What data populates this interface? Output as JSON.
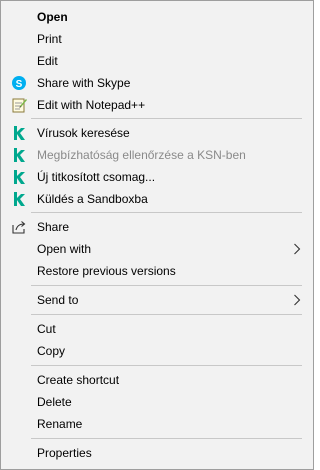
{
  "menu": {
    "open": "Open",
    "print": "Print",
    "edit": "Edit",
    "share_skype": "Share with Skype",
    "edit_notepad": "Edit with Notepad++",
    "kaspersky_scan": "Vírusok keresése",
    "kaspersky_ksn": "Megbízhatóság ellenőrzése a KSN-ben",
    "kaspersky_repack": "Új titkosított csomag...",
    "kaspersky_sandbox": "Küldés a Sandboxba",
    "share": "Share",
    "open_with": "Open with",
    "restore": "Restore previous versions",
    "send_to": "Send to",
    "cut": "Cut",
    "copy": "Copy",
    "create_shortcut": "Create shortcut",
    "delete": "Delete",
    "rename": "Rename",
    "properties": "Properties"
  },
  "icons": {
    "skype": "skype-icon",
    "notepad": "notepad-plus-plus-icon",
    "kaspersky": "kaspersky-k-icon",
    "share": "share-icon",
    "submenu": "chevron-right-icon"
  },
  "colors": {
    "menu_bg": "#f2f2f2",
    "separator": "#c8c8c8",
    "disabled_text": "#8a8a8a",
    "skype_blue": "#00aff0",
    "kaspersky_teal": "#00a88e"
  }
}
